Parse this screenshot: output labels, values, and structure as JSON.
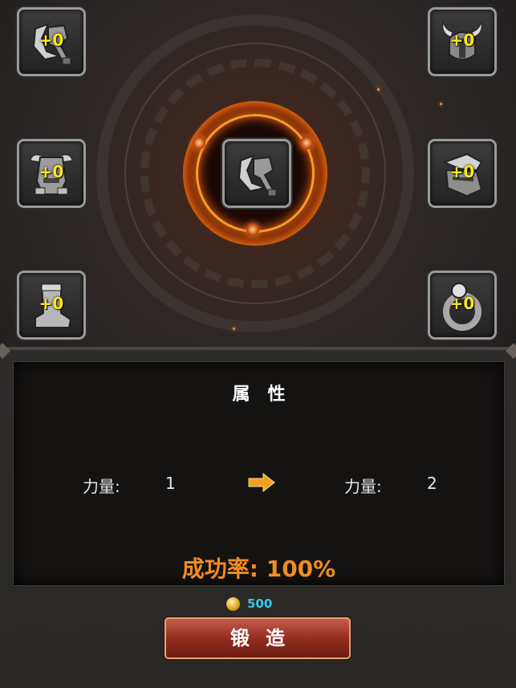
{
  "equipment_slots": [
    {
      "name": "weapon",
      "level": "+0"
    },
    {
      "name": "helmet",
      "level": "+0"
    },
    {
      "name": "armor",
      "level": "+0"
    },
    {
      "name": "shoulder",
      "level": "+0"
    },
    {
      "name": "boots",
      "level": "+0"
    },
    {
      "name": "ring",
      "level": "+0"
    }
  ],
  "center_slot": {
    "name": "weapon"
  },
  "attributes": {
    "title": "属性",
    "current_label": "力量:",
    "current_value": "1",
    "next_label": "力量:",
    "next_value": "2",
    "success_rate": "成功率: 100%"
  },
  "cost": {
    "icon": "coin-icon",
    "amount": "500"
  },
  "forge_button": {
    "label": "锻造"
  },
  "colors": {
    "level_text": "#ffe81a",
    "success_rate": "#f08c22",
    "cost_text": "#39c9e8",
    "button": "#8e2a1e"
  }
}
